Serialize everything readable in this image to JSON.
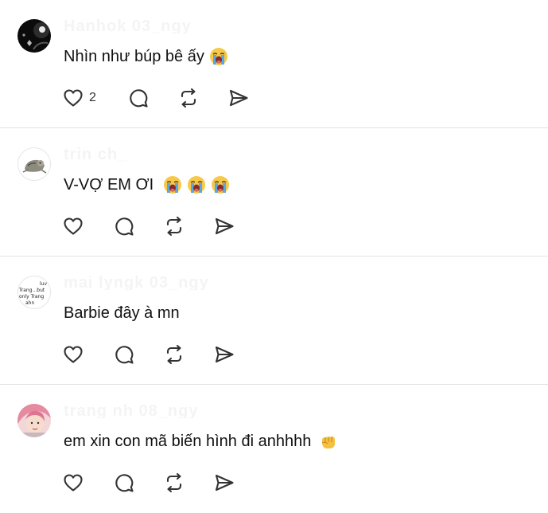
{
  "comments": [
    {
      "username": "Hanhok 03_ngy",
      "text": "Nhìn như búp bê ấy",
      "emoji": [
        "loudly-crying-face"
      ],
      "like_count": "2",
      "avatar": "dark-sparkle-avatar"
    },
    {
      "username": "trin ch_",
      "text": "V-VỢ EM ƠI",
      "emoji": [
        "loudly-crying-face",
        "loudly-crying-face",
        "loudly-crying-face"
      ],
      "like_count": "",
      "avatar": "cat-avatar"
    },
    {
      "username": "mai lyngk 03_ngy",
      "text": "Barbie đây à mn",
      "emoji": [],
      "like_count": "",
      "avatar": "text-sticker-avatar",
      "avatar_text": [
        "luv",
        "Trang...but",
        "only  Trang",
        "ahn"
      ]
    },
    {
      "username": "trang nh 08_ngy",
      "text": "em xin con mã biến hình đi anhhhh",
      "emoji": [
        "fist-emoji"
      ],
      "like_count": "",
      "avatar": "pink-hair-avatar"
    }
  ],
  "colors": {
    "icon": "#333333",
    "divider": "#e2e2e2",
    "text": "#111111"
  }
}
